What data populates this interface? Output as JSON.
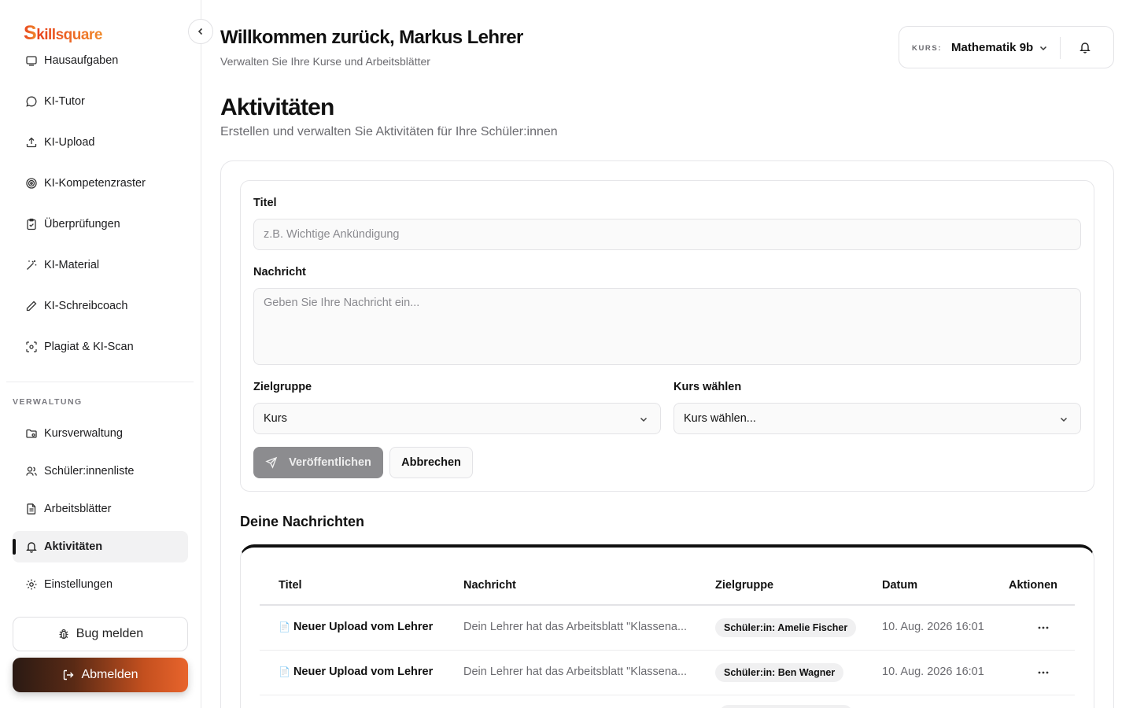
{
  "app": {
    "logo_initial": "S",
    "logo_rest": "killsquare"
  },
  "sidebar": {
    "items_top": [
      {
        "label": "Hausaufgaben",
        "icon": "homework-icon"
      },
      {
        "label": "KI-Tutor",
        "icon": "chat-bubble-icon"
      },
      {
        "label": "KI-Upload",
        "icon": "upload-icon"
      },
      {
        "label": "KI-Kompetenzraster",
        "icon": "target-icon"
      },
      {
        "label": "Überprüfungen",
        "icon": "clipboard-check-icon"
      },
      {
        "label": "KI-Material",
        "icon": "magic-wand-icon"
      },
      {
        "label": "KI-Schreibcoach",
        "icon": "pen-icon"
      },
      {
        "label": "Plagiat & KI-Scan",
        "icon": "scan-icon"
      }
    ],
    "section_label": "VERWALTUNG",
    "items_admin": [
      {
        "label": "Kursverwaltung",
        "icon": "folder-settings-icon"
      },
      {
        "label": "Schüler:innenliste",
        "icon": "users-icon"
      },
      {
        "label": "Arbeitsblätter",
        "icon": "document-icon"
      },
      {
        "label": "Aktivitäten",
        "icon": "bell-icon",
        "active": true
      },
      {
        "label": "Einstellungen",
        "icon": "gear-icon"
      }
    ],
    "bug_label": "Bug melden",
    "logout_label": "Abmelden"
  },
  "header": {
    "welcome": "Willkommen zurück, Markus Lehrer",
    "subtitle": "Verwalten Sie Ihre Kurse und Arbeitsblätter",
    "course_label": "KURS:",
    "course_value": "Mathematik 9b"
  },
  "page": {
    "title": "Aktivitäten",
    "subtitle": "Erstellen und verwalten Sie Aktivitäten für Ihre Schüler:innen"
  },
  "form": {
    "title_label": "Titel",
    "title_placeholder": "z.B. Wichtige Ankündigung",
    "message_label": "Nachricht",
    "message_placeholder": "Geben Sie Ihre Nachricht ein...",
    "target_label": "Zielgruppe",
    "target_value": "Kurs",
    "course_label": "Kurs wählen",
    "course_value": "Kurs wählen...",
    "publish_label": "Veröffentlichen",
    "cancel_label": "Abbrechen"
  },
  "messages": {
    "section_title": "Deine Nachrichten",
    "columns": [
      "Titel",
      "Nachricht",
      "Zielgruppe",
      "Datum",
      "Aktionen"
    ],
    "rows": [
      {
        "title": "Neuer Upload vom Lehrer",
        "message": "Dein Lehrer hat das Arbeitsblatt \"Klassena...",
        "target": "Schüler:in: Amelie Fischer",
        "date": "10. Aug. 2026 16:01"
      },
      {
        "title": "Neuer Upload vom Lehrer",
        "message": "Dein Lehrer hat das Arbeitsblatt \"Klassena...",
        "target": "Schüler:in: Ben Wagner",
        "date": "10. Aug. 2026 16:01"
      }
    ]
  },
  "colors": {
    "accent_start": "#e8421f",
    "accent_end": "#f08a2b",
    "publish_disabled": "#8c8c8f"
  }
}
